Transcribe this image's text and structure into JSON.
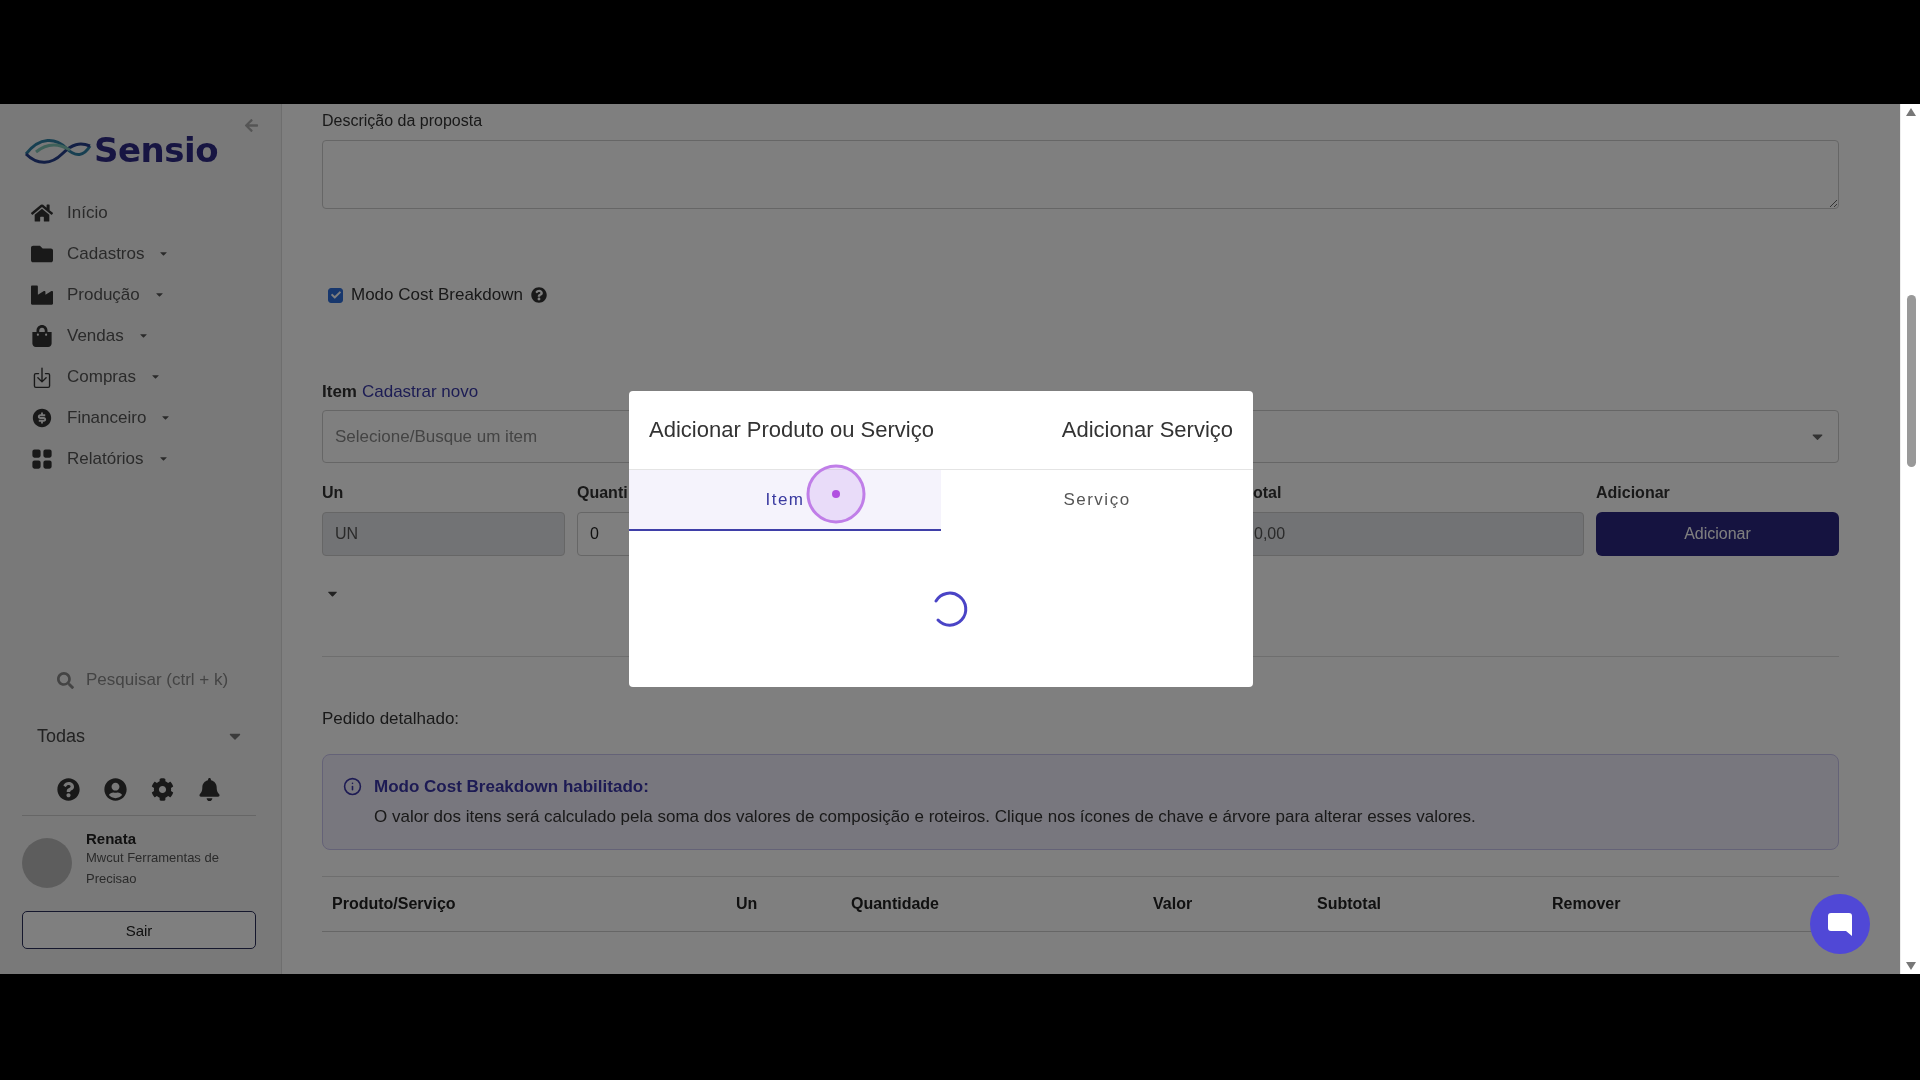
{
  "sidebar": {
    "logo": "Sensio",
    "nav": [
      {
        "label": "Início",
        "dropdown": false
      },
      {
        "label": "Cadastros",
        "dropdown": true
      },
      {
        "label": "Produção",
        "dropdown": true
      },
      {
        "label": "Vendas",
        "dropdown": true
      },
      {
        "label": "Compras",
        "dropdown": true
      },
      {
        "label": "Financeiro",
        "dropdown": true
      },
      {
        "label": "Relatórios",
        "dropdown": true
      }
    ],
    "search": {
      "placeholder": "Pesquisar (ctrl + k)"
    },
    "company_filter": "Todas",
    "user": {
      "name": "Renata",
      "company": "Mwcut Ferramentas de Precisao"
    },
    "logout": "Sair"
  },
  "form": {
    "description_label": "Descrição da proposta",
    "cost_breakdown": {
      "label": "Modo Cost Breakdown",
      "checked": true
    },
    "item_label": "Item",
    "item_link": "Cadastrar novo",
    "item_select": {
      "placeholder": "Selecione/Busque um item"
    },
    "fields": [
      {
        "label": "Un",
        "value": "UN",
        "disabled": true
      },
      {
        "label": "Quanti",
        "value": "0",
        "disabled": false
      },
      {
        "label": "otal",
        "value": "0,00",
        "disabled": true
      }
    ],
    "add": {
      "label": "Adicionar",
      "button": "Adicionar"
    }
  },
  "order": {
    "title": "Pedido detalhado:",
    "alert": {
      "title": "Modo Cost Breakdown habilitado:",
      "text": "O valor dos itens será calculado pela soma dos valores de composição e roteiros. Clique nos ícones de chave e árvore para alterar esses valores."
    },
    "columns": [
      "Produto/Serviço",
      "Un",
      "Quantidade",
      "Valor",
      "Subtotal",
      "Remover"
    ]
  },
  "modal": {
    "title": "Adicionar Produto ou Serviço",
    "title_right": "Adicionar Serviço",
    "tabs": [
      {
        "label": "Item",
        "selected": true
      },
      {
        "label": "Serviço",
        "selected": false
      }
    ],
    "loading": true
  }
}
